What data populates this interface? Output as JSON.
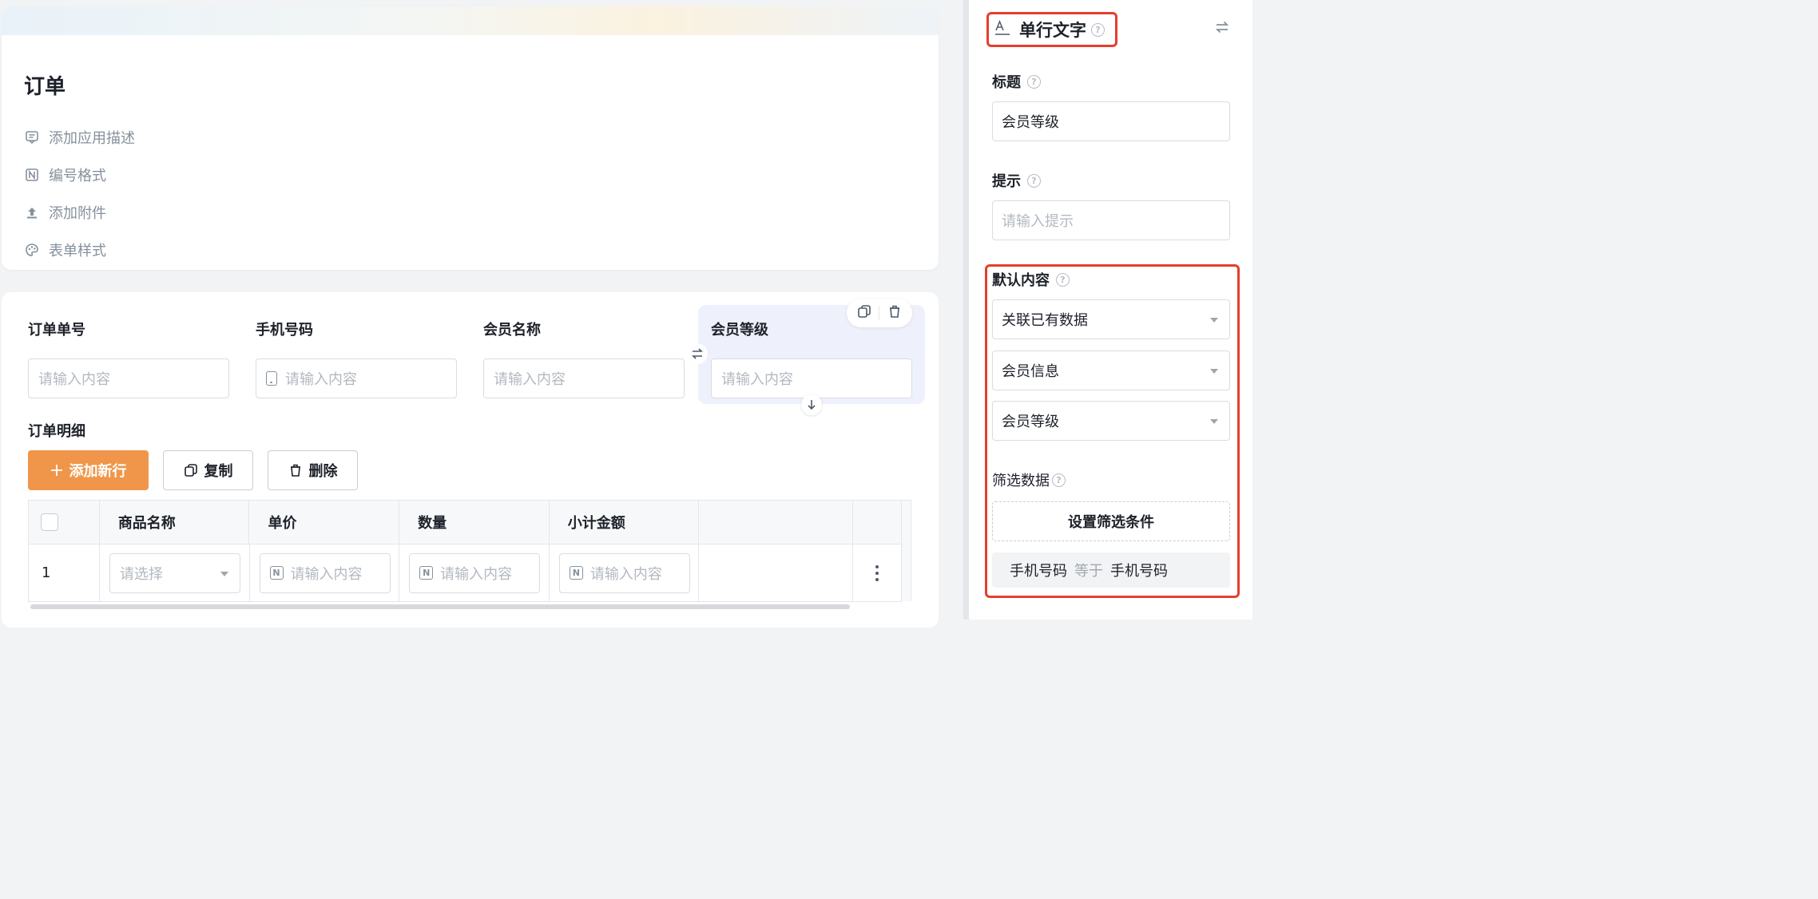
{
  "form": {
    "title": "订单",
    "meta_items": [
      {
        "label": "添加应用描述",
        "icon": "comment-icon"
      },
      {
        "label": "编号格式",
        "icon": "number-format-icon"
      },
      {
        "label": "添加附件",
        "icon": "upload-icon"
      },
      {
        "label": "表单样式",
        "icon": "palette-icon"
      }
    ]
  },
  "fields": [
    {
      "label": "订单单号",
      "placeholder": "请输入内容"
    },
    {
      "label": "手机号码",
      "placeholder": "请输入内容"
    },
    {
      "label": "会员名称",
      "placeholder": "请输入内容"
    },
    {
      "label": "会员等级",
      "placeholder": "请输入内容"
    }
  ],
  "subform": {
    "title": "订单明细",
    "buttons": {
      "add": "添加新行",
      "copy": "复制",
      "delete": "删除"
    },
    "columns": [
      "商品名称",
      "单价",
      "数量",
      "小计金额"
    ],
    "rows": [
      {
        "index": "1",
        "product_placeholder": "请选择",
        "price_placeholder": "请输入内容",
        "qty_placeholder": "请输入内容",
        "subtotal_placeholder": "请输入内容"
      }
    ]
  },
  "panel": {
    "header": {
      "title": "单行文字",
      "icon": "text-field-icon"
    },
    "title_label": "标题",
    "title_value": "会员等级",
    "hint_label": "提示",
    "hint_placeholder": "请输入提示",
    "default_label": "默认内容",
    "default_mode": "关联已有数据",
    "source_form": "会员信息",
    "source_field": "会员等级",
    "filter_label": "筛选数据",
    "filter_button": "设置筛选条件",
    "condition": {
      "left": "手机号码",
      "op": "等于",
      "right": "手机号码"
    }
  },
  "colors": {
    "accent": "#f0964a",
    "highlight": "#e53e2e",
    "selected_bg": "#eef1fb"
  }
}
